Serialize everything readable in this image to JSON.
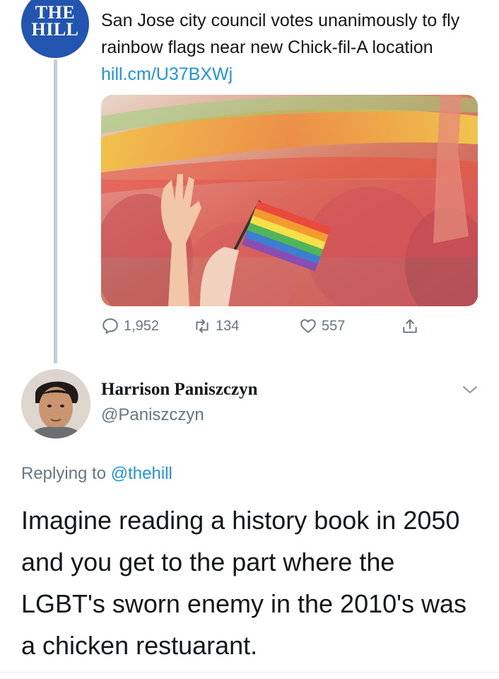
{
  "top_tweet": {
    "account_logo_text": "THE HILL",
    "logo_line1": "THE",
    "logo_line2": "HILL",
    "text": "San Jose city council votes unanimously to fly rainbow flags near new Chick-fil-A location",
    "link": "hill.cm/U37BXWj",
    "image_alt": "Rainbow flags raised at a pride event",
    "actions": {
      "replies": "1,952",
      "retweets": "134",
      "likes": "557"
    }
  },
  "reply_tweet": {
    "name": "Harrison Paniszczyn",
    "handle": "@Paniszczyn",
    "replying_prefix": "Replying to",
    "replying_to": "@thehill",
    "text": "Imagine reading a history book in 2050 and you get to the part where the LGBT's sworn enemy in the 2010's was a chicken restuarant."
  },
  "colors": {
    "accent": "#1b95e0",
    "muted": "#657786",
    "logo_blue": "#2255b0"
  }
}
